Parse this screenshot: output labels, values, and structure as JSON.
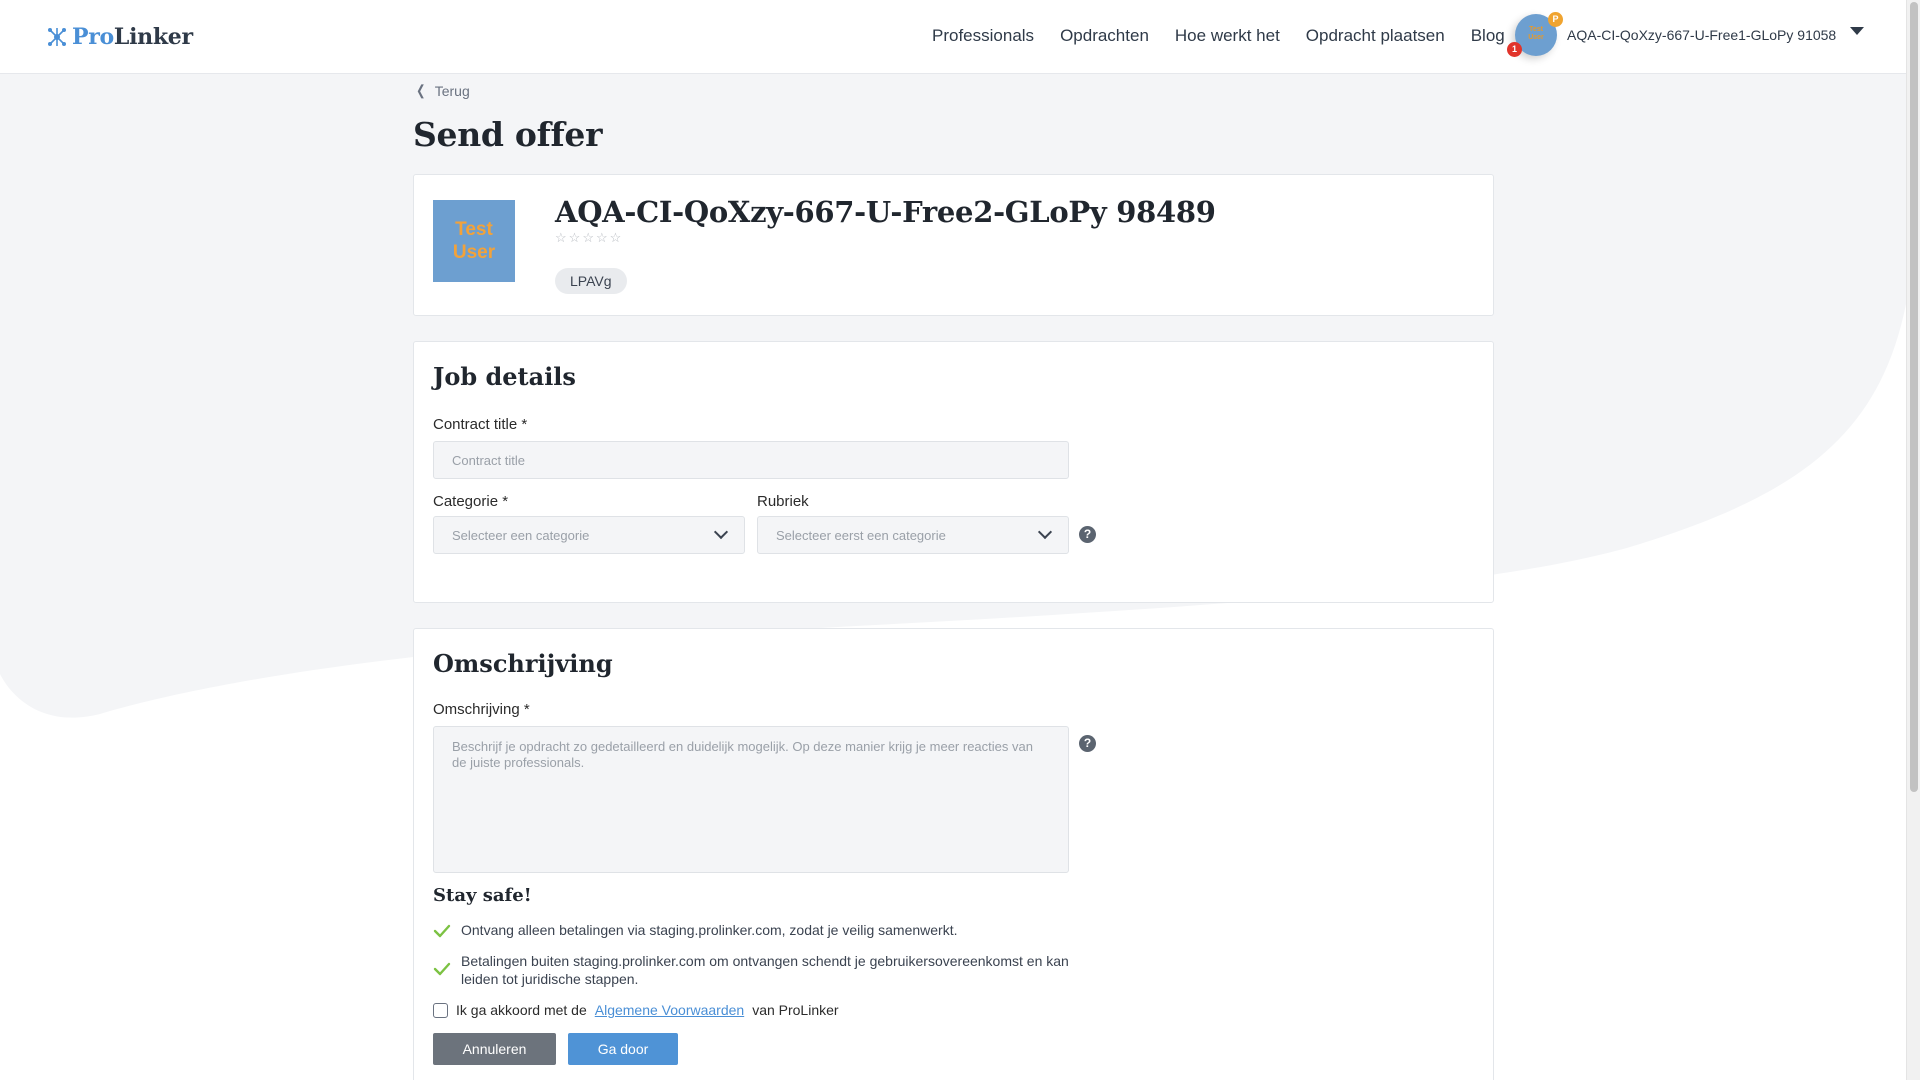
{
  "header": {
    "logo_pro": "Pro",
    "logo_linker": "Linker",
    "nav": [
      "Professionals",
      "Opdrachten",
      "Hoe werkt het",
      "Opdracht plaatsen",
      "Blog"
    ],
    "user": {
      "name": "AQA-CI-QoXzy-667-U-Free1-GLoPy 91058",
      "avatar_text_1": "Test",
      "avatar_text_2": "User",
      "points_badge": "P",
      "notification_count": "1"
    }
  },
  "back_label": "Terug",
  "page_title": "Send offer",
  "profile": {
    "name": "AQA-CI-QoXzy-667-U-Free2-GLoPy 98489",
    "avatar_line1": "Test",
    "avatar_line2": "User",
    "rating": 0,
    "stars_max": 5,
    "tag": "LPAVg"
  },
  "job_details": {
    "title": "Job details",
    "contract_title_label": "Contract title *",
    "contract_title_placeholder": "Contract title",
    "category_label": "Categorie *",
    "category_placeholder": "Selecteer een categorie",
    "rubriek_label": "Rubriek",
    "rubriek_placeholder": "Selecteer eerst een categorie",
    "help_glyph": "?"
  },
  "description": {
    "title": "Omschrijving",
    "label": "Omschrijving *",
    "placeholder": "Beschrijf je opdracht zo gedetailleerd en duidelijk mogelijk. Op deze manier krijg je meer reacties van de juiste professionals.",
    "stay_safe_title": "Stay safe!",
    "safe_items": [
      "Ontvang alleen betalingen via staging.prolinker.com, zodat je veilig samenwerkt.",
      "Betalingen buiten staging.prolinker.com om ontvangen schendt je gebruikersovereenkomst en kan leiden tot juridische stappen."
    ],
    "agree_prefix": "Ik ga akkoord met de",
    "agree_link": "Algemene Voorwaarden",
    "agree_suffix": "van ProLinker",
    "cancel_label": "Annuleren",
    "next_label": "Ga door"
  },
  "colors": {
    "brand_blue": "#4a8fd6",
    "check_green": "#7cc243",
    "button_grey": "#6c737c"
  }
}
